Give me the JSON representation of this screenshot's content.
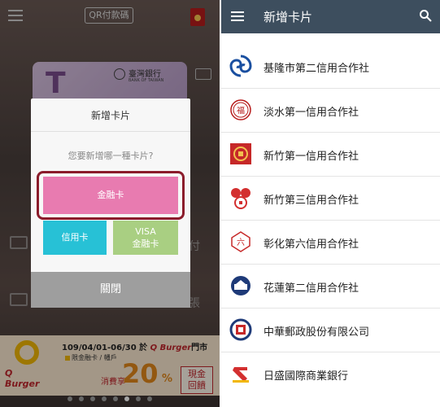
{
  "left": {
    "top_button": "QR付款碼",
    "card": {
      "bank_name": "臺灣銀行",
      "bank_name_en": "BANK OF TAIWAN",
      "letter": "T"
    },
    "side_fragments": [
      "付",
      "張"
    ],
    "dialog": {
      "title": "新增卡片",
      "question": "您要新增哪一種卡片?",
      "debit_label": "金融卡",
      "credit_label": "信用卡",
      "visa_line1": "VISA",
      "visa_line2": "金融卡",
      "close_label": "關閉"
    },
    "promo": {
      "brand": "Q Burger",
      "date_line": "109/04/01-06/30",
      "date_suffix": "於",
      "store_brand": "Q Burger",
      "store_suffix": "門市",
      "limit_line": "限金融卡 / 幡戶",
      "prefix": "消費享",
      "percent": "20",
      "percent_sign": "%",
      "badge_line1": "現金",
      "badge_line2": "回饋"
    },
    "pagination": {
      "count": 8,
      "active_index": 5
    }
  },
  "right": {
    "title": "新增卡片",
    "banks": [
      {
        "name": "基隆市第二信用合作社",
        "icon": "swirl-logo-icon",
        "color": "#1a4fa0"
      },
      {
        "name": "淡水第一信用合作社",
        "icon": "fu-seal-icon",
        "color": "#b71c1c"
      },
      {
        "name": "新竹第一信用合作社",
        "icon": "red-square-logo-icon",
        "color": "#c62828"
      },
      {
        "name": "新竹第三信用合作社",
        "icon": "coin-logo-icon",
        "color": "#d32f2f"
      },
      {
        "name": "彰化第六信用合作社",
        "icon": "liu-seal-icon",
        "color": "#c62828"
      },
      {
        "name": "花蓮第二信用合作社",
        "icon": "circle-bank-logo-icon",
        "color": "#1e3a78"
      },
      {
        "name": "中華郵政股份有限公司",
        "icon": "post-logo-icon",
        "color": "#c62828"
      },
      {
        "name": "日盛國際商業銀行",
        "icon": "jihsun-logo-icon",
        "color": "#d32f2f"
      }
    ]
  }
}
